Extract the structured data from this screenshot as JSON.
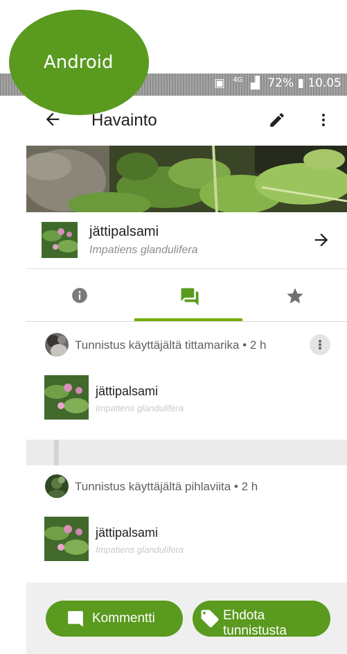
{
  "badge": {
    "label": "Android"
  },
  "status_bar": {
    "network": "4G",
    "battery": "72%",
    "time": "10.05"
  },
  "app_bar": {
    "title": "Havainto"
  },
  "taxon": {
    "common_name": "jättipalsami",
    "scientific_name": "Impatiens glandulifera"
  },
  "tabs": [
    {
      "name": "info",
      "icon": "info-icon",
      "active": false
    },
    {
      "name": "activity",
      "icon": "comments-icon",
      "active": true
    },
    {
      "name": "favorites",
      "icon": "star-icon",
      "active": false
    }
  ],
  "activity": [
    {
      "header": "Tunnistus käyttäjältä tittamarika • 2 h",
      "common_name": "jättipalsami",
      "scientific_name": "Impatiens glandulifera"
    },
    {
      "header": "Tunnistus käyttäjältä pihlaviita • 2 h",
      "common_name": "jättipalsami",
      "scientific_name": "Impatiens glandulifera"
    }
  ],
  "actions": {
    "comment": "Kommentti",
    "suggest": "Ehdota tunnistusta"
  },
  "colors": {
    "accent": "#74ac00",
    "button": "#5a9a1f"
  }
}
